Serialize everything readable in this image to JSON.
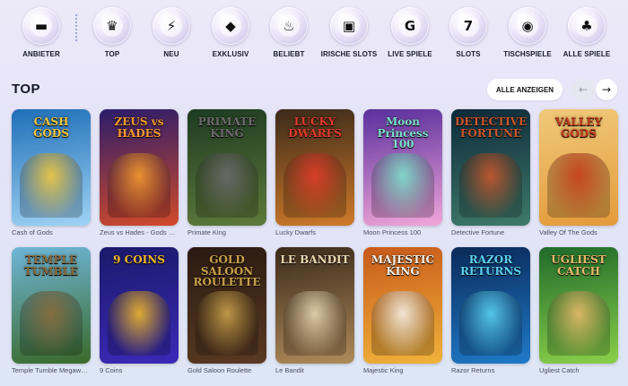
{
  "categories": [
    {
      "key": "anbieter",
      "label": "ANBIETER",
      "icon": "folder-icon",
      "glyph": "▬"
    },
    {
      "key": "top",
      "label": "TOP",
      "icon": "crown-icon",
      "glyph": "♛"
    },
    {
      "key": "neu",
      "label": "NEU",
      "icon": "lightning-icon",
      "glyph": "⚡"
    },
    {
      "key": "exklusiv",
      "label": "EXKLUSIV",
      "icon": "diamond-icon",
      "glyph": "◆"
    },
    {
      "key": "beliebt",
      "label": "BELIEBT",
      "icon": "fire-icon",
      "glyph": "♨"
    },
    {
      "key": "irische-slots",
      "label": "IRISCHE SLOTS",
      "icon": "leprechaun-hat-icon",
      "glyph": "▣"
    },
    {
      "key": "live-spiele",
      "label": "LIVE SPIELE",
      "icon": "live-casino-chip-icon",
      "glyph": "G"
    },
    {
      "key": "slots",
      "label": "SLOTS",
      "icon": "slot-777-icon",
      "glyph": "7"
    },
    {
      "key": "tischspiele",
      "label": "TISCHSPIELE",
      "icon": "roulette-icon",
      "glyph": "◉"
    },
    {
      "key": "alle-spiele",
      "label": "ALLE SPIELE",
      "icon": "cherries-icon",
      "glyph": "♣"
    }
  ],
  "section": {
    "title": "TOP",
    "show_all_label": "ALLE ANZEIGEN",
    "prev_icon": "arrow-left-icon",
    "next_icon": "arrow-right-icon",
    "prev_glyph": "←",
    "next_glyph": "→"
  },
  "games_row1": [
    {
      "name": "Cash of Gods",
      "logo": "CASH GODS",
      "bg": [
        "#1f6fb8",
        "#9fd3f4"
      ],
      "accent": "#f2c53a",
      "new": true
    },
    {
      "name": "Zeus vs Hades - Gods of War",
      "logo": "ZEUS vs HADES",
      "bg": [
        "#2b1d6b",
        "#d24a2a"
      ],
      "accent": "#f59a2e",
      "new": false
    },
    {
      "name": "Primate King",
      "logo": "PRIMATE KING",
      "bg": [
        "#1d3b22",
        "#5f7a3a"
      ],
      "accent": "#6b6b6b",
      "new": false
    },
    {
      "name": "Lucky Dwarfs",
      "logo": "LUCKY DWARFS",
      "bg": [
        "#3a2a1a",
        "#d07a2a"
      ],
      "accent": "#e03a2a",
      "new": true
    },
    {
      "name": "Moon Princess 100",
      "logo": "Moon Princess 100",
      "bg": [
        "#5b2f9e",
        "#f0a6d8"
      ],
      "accent": "#7be0c9",
      "new": false
    },
    {
      "name": "Detective Fortune",
      "logo": "DETECTIVE FORTUNE",
      "bg": [
        "#0d2a3a",
        "#3f7a6a"
      ],
      "accent": "#c8562a",
      "new": false
    },
    {
      "name": "Valley Of The Gods",
      "logo": "VALLEY GODS",
      "bg": [
        "#f0c97a",
        "#e49a3a"
      ],
      "accent": "#c23a1a",
      "new": false
    }
  ],
  "games_row2": [
    {
      "name": "Temple Tumble Megaways",
      "logo": "TEMPLE TUMBLE",
      "bg": [
        "#6fb6d8",
        "#3a6a2a"
      ],
      "accent": "#8a6a3a",
      "new": false
    },
    {
      "name": "9 Coins",
      "logo": "9 COINS",
      "bg": [
        "#1a1a6a",
        "#3a2ab8"
      ],
      "accent": "#f2b92a",
      "new": false
    },
    {
      "name": "Gold Saloon Roulette",
      "logo": "GOLD SALOON ROULETTE",
      "bg": [
        "#2a1a12",
        "#5a3a22"
      ],
      "accent": "#c9a14a",
      "new": true
    },
    {
      "name": "Le Bandit",
      "logo": "LE BANDIT",
      "bg": [
        "#3a2a1a",
        "#b08a5a"
      ],
      "accent": "#e8d6b0",
      "new": false
    },
    {
      "name": "Majestic King",
      "logo": "MAJESTIC KING",
      "bg": [
        "#c85a1a",
        "#f0b23a"
      ],
      "accent": "#f4efe6",
      "new": false
    },
    {
      "name": "Razor Returns",
      "logo": "RAZOR RETURNS",
      "bg": [
        "#0a2a5a",
        "#1f7ac8"
      ],
      "accent": "#5ad0f0",
      "new": false
    },
    {
      "name": "Ugliest Catch",
      "logo": "UGLIEST CATCH",
      "bg": [
        "#1f6a2a",
        "#8ad04a"
      ],
      "accent": "#e8b86a",
      "new": false
    }
  ]
}
